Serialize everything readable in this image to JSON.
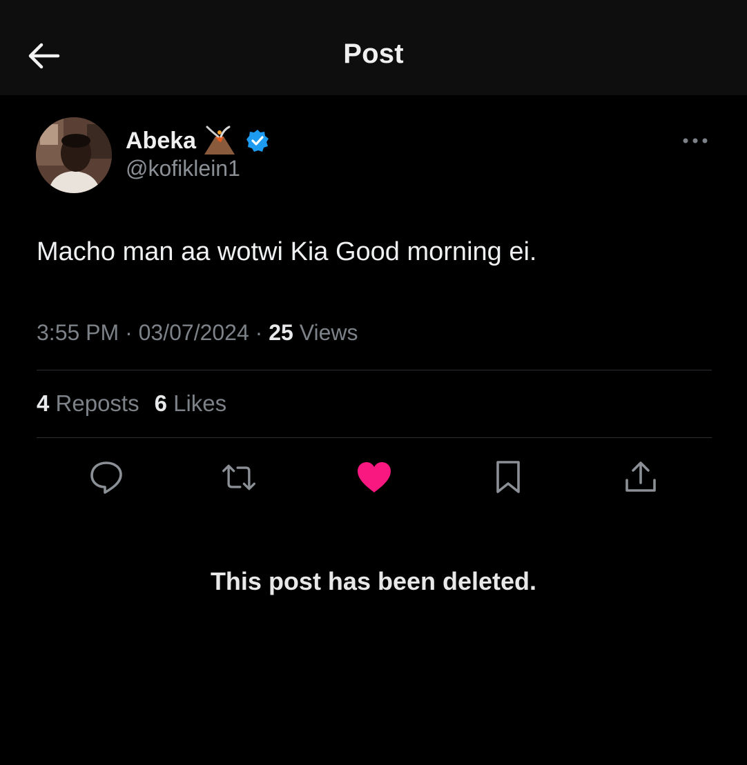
{
  "header": {
    "title": "Post",
    "back_icon": "arrow-left-icon"
  },
  "author": {
    "display_name": "Abeka",
    "name_emoji": "volcano-icon",
    "verified_icon": "verified-badge-icon",
    "verified_color": "#1d9bf0",
    "handle": "@kofiklein1"
  },
  "post": {
    "text": "Macho man aa wotwi Kia Good morning ei.",
    "time": "3:55 PM",
    "date": "03/07/2024",
    "separator": "·",
    "views_count": "25",
    "views_label": "Views"
  },
  "stats": {
    "reposts_count": "4",
    "reposts_label": "Reposts",
    "likes_count": "6",
    "likes_label": "Likes"
  },
  "actions": [
    {
      "icon": "reply-icon"
    },
    {
      "icon": "repost-icon"
    },
    {
      "icon": "heart-icon",
      "active": true,
      "color": "#f91880"
    },
    {
      "icon": "bookmark-icon"
    },
    {
      "icon": "share-icon"
    }
  ],
  "notice": {
    "text": "This post has been deleted."
  },
  "colors": {
    "background": "#000000",
    "header_background": "#0e0e0e",
    "secondary_text": "#7d8288",
    "like_pink": "#f91880"
  }
}
